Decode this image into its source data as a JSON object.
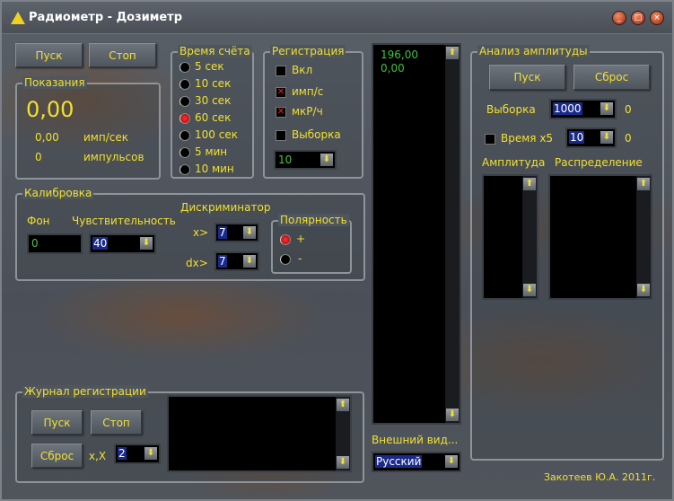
{
  "window": {
    "title": "Радиометр - Дозиметр",
    "controls": [
      "_",
      "□",
      "×"
    ]
  },
  "main": {
    "start": "Пуск",
    "stop": "Стоп"
  },
  "readings": {
    "title": "Показания",
    "value": "0,00",
    "rate": "0,00",
    "rate_unit": "имп/сек",
    "count": "0",
    "count_unit": "импульсов"
  },
  "count_time": {
    "title": "Время счёта",
    "options": [
      "5 сек",
      "10 сек",
      "30 сек",
      "60 сек",
      "100 сек",
      "5 мин",
      "10 мин"
    ],
    "selected": 3
  },
  "registration": {
    "title": "Регистрация",
    "checks": [
      {
        "label": "Вкл",
        "checked": false
      },
      {
        "label": "имп/с",
        "checked": true
      },
      {
        "label": "мкР/ч",
        "checked": true
      },
      {
        "label": "Выборка",
        "checked": false
      }
    ],
    "combo": "10"
  },
  "calibration": {
    "title": "Калибровка",
    "bg_label": "Фон",
    "bg_value": "0",
    "sens_label": "Чувствительность",
    "sens_value": "40",
    "disc_label": "Дискриминатор",
    "x_label": "x>",
    "x_value": "7",
    "dx_label": "dx>",
    "dx_value": "7",
    "polarity": {
      "title": "Полярность",
      "plus": "+",
      "minus": "-",
      "selected": "+"
    }
  },
  "output_list": [
    "196,00",
    "0,00"
  ],
  "appearance": {
    "label": "Внешний вид...",
    "value": "Русский"
  },
  "amplitude": {
    "title": "Анализ амплитуды",
    "start": "Пуск",
    "reset": "Сброс",
    "sample_label": "Выборка",
    "sample_value": "1000",
    "sample_count": "0",
    "time_label": "Время x5",
    "time_value": "10",
    "time_count": "0",
    "amp_label": "Амплитуда",
    "dist_label": "Распределение"
  },
  "journal": {
    "title": "Журнал регистрации",
    "start": "Пуск",
    "stop": "Стоп",
    "reset": "Сброс",
    "xx_label": "x,X",
    "xx_value": "2"
  },
  "footer": {
    "author": "Закотеев Ю.А. 2011г."
  }
}
